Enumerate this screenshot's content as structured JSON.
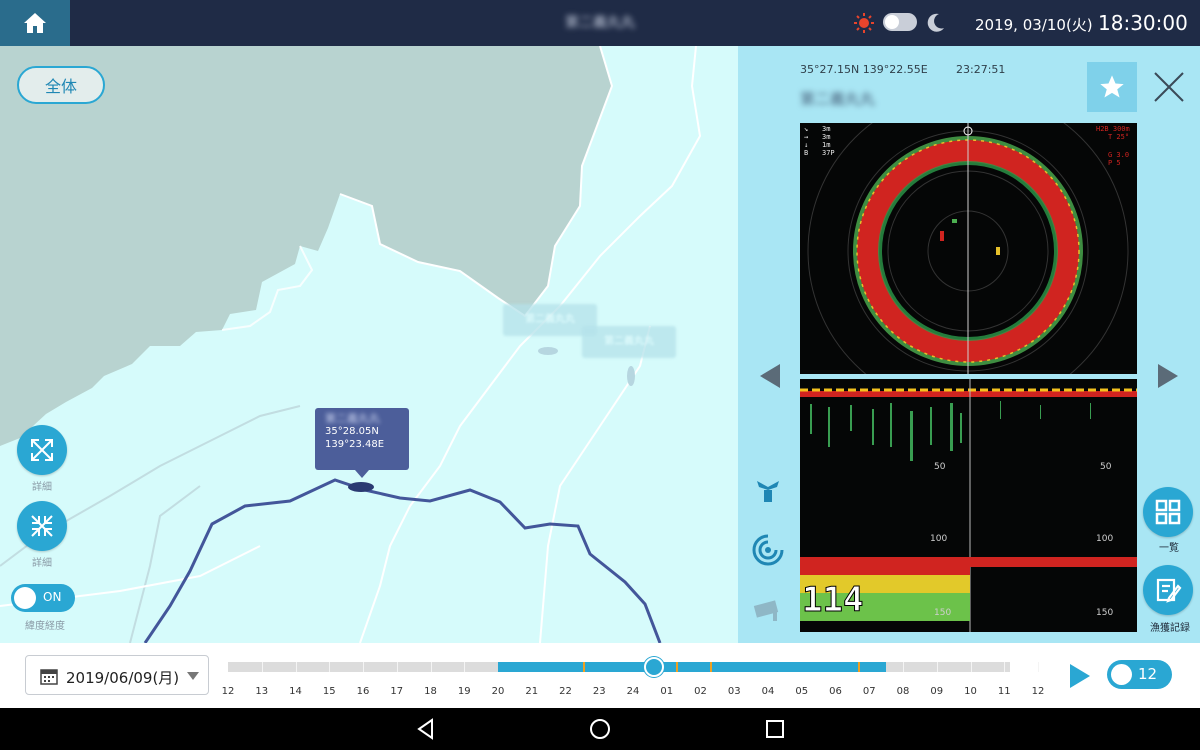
{
  "topbar": {
    "vessel_name": "第二義丸丸",
    "date": "2019, 03/10(火)",
    "time": "18:30:00"
  },
  "map": {
    "all_button_label": "全体",
    "popup": {
      "name": "第二義丸丸",
      "lat": "35°28.05N",
      "lon": "139°23.48E"
    },
    "ghost_labels": [
      "第二義丸丸",
      "第二義丸丸"
    ],
    "zoom_out_caption": "詳細",
    "zoom_in_caption": "詳細",
    "latlon_toggle_label": "ON",
    "latlon_caption": "緯度経度"
  },
  "panel": {
    "coordinates": "35°27.15N 139°22.55E",
    "time": "23:27:51",
    "vessel_name": "第二義丸丸",
    "sonar_top": {
      "left_readouts": [
        "3m",
        "3m",
        "1m",
        "37P"
      ],
      "right_readouts": [
        "H2B 300m",
        "T 25°",
        "G 3.0",
        "P 5"
      ]
    },
    "sonar_bottom": {
      "depth_labels": [
        "50",
        "100",
        "150"
      ],
      "big_number": "114"
    },
    "list_caption": "一覧",
    "catch_caption": "漁獲記録"
  },
  "timeline": {
    "date": "2019/06/09(月)",
    "hours": [
      "12",
      "13",
      "14",
      "15",
      "16",
      "17",
      "18",
      "19",
      "20",
      "21",
      "22",
      "23",
      "24",
      "01",
      "02",
      "03",
      "04",
      "05",
      "06",
      "07",
      "08",
      "09",
      "10",
      "11",
      "12"
    ],
    "speed_label": "12",
    "progress": 0.545
  },
  "colors": {
    "accent": "#2aa7d3",
    "topbar": "#1f2b46",
    "sea": "#d6fbfb",
    "land": "#b8d3d0",
    "track": "#43569a",
    "panel": "#a9e6f4"
  }
}
